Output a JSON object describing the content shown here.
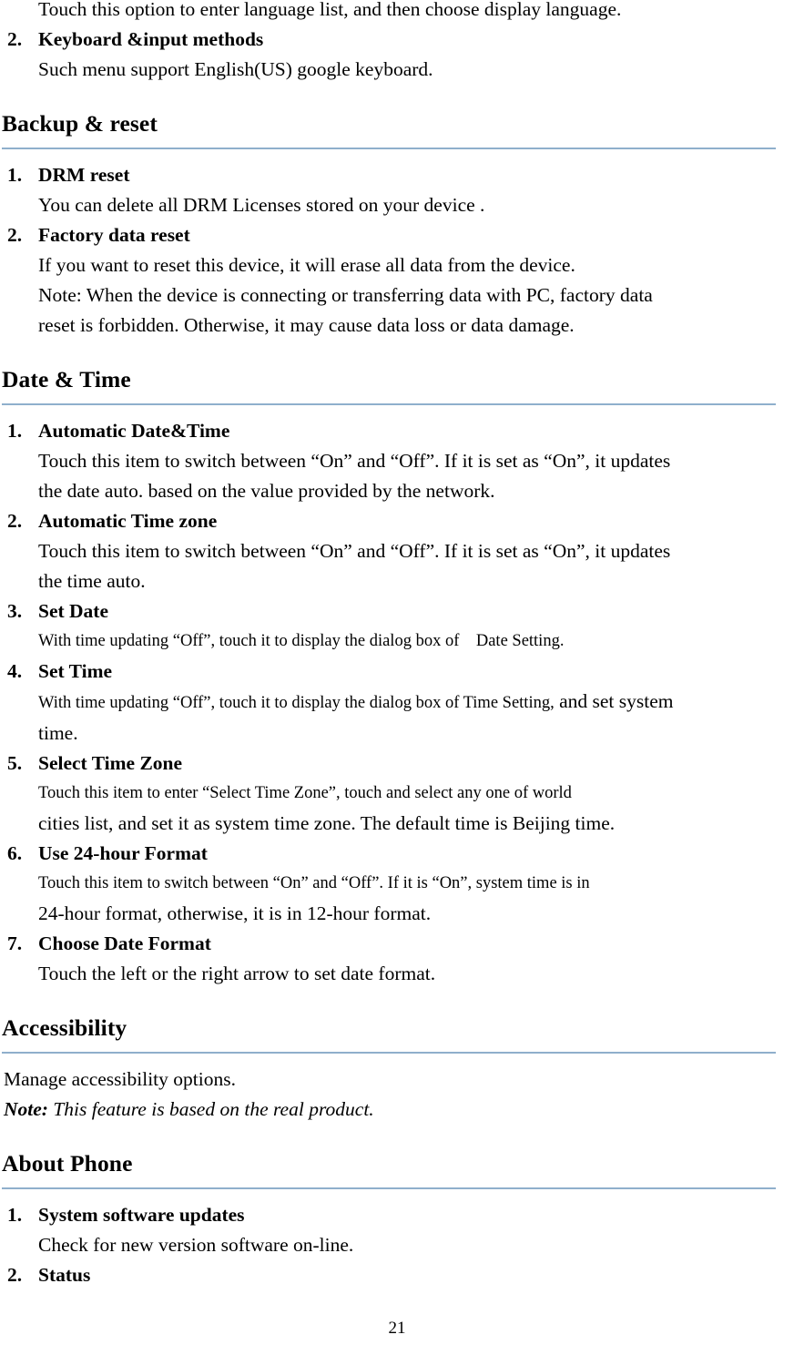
{
  "document": {
    "page_number": "21",
    "rule_color": "#8fafcc"
  },
  "top_fragment": {
    "continuation_line": "Touch this option to enter language list, and then choose display language.",
    "item": {
      "number": "2.",
      "title": "Keyboard &input methods",
      "body": "Such menu support English(US) google keyboard."
    }
  },
  "sections": [
    {
      "heading": "Backup & reset",
      "items": [
        {
          "number": "1.",
          "title": "DRM reset",
          "lines": [
            "You can delete all DRM Licenses stored on your device ."
          ]
        },
        {
          "number": "2.",
          "title": "Factory data reset",
          "lines": [
            "If you want to reset this device, it will erase all data from the device.",
            "Note: When the device is connecting or transferring data with PC, factory data",
            "reset is forbidden. Otherwise, it may cause data loss or data damage."
          ]
        }
      ]
    },
    {
      "heading": "Date & Time",
      "items": [
        {
          "number": "1.",
          "title": "Automatic Date&Time",
          "lines": [
            "Touch this item to switch between “On” and “Off”. If it is set as “On”, it updates",
            "the date auto. based on the value provided by the network."
          ]
        },
        {
          "number": "2.",
          "title": "Automatic Time zone",
          "lines": [
            "Touch this item to switch between “On” and “Off”. If it is set as “On”, it updates",
            "the time auto."
          ]
        },
        {
          "number": "3.",
          "title": "Set Date",
          "lines": [
            "With time updating “Off”, touch it to display the dialog box of    Date Setting."
          ]
        },
        {
          "number": "4.",
          "title": "Set Time",
          "line_small": "With time updating “Off”, touch it to display the dialog box of Time Setting,",
          "line_small_tail_big": " and set system",
          "line_after": "time."
        },
        {
          "number": "5.",
          "title": "Select Time Zone",
          "lines": [
            "Touch this item to enter “Select Time Zone”, touch and select any one of world",
            "cities list, and set it as system time zone. The default time is Beijing time."
          ]
        },
        {
          "number": "6.",
          "title": "Use 24-hour Format",
          "lines": [
            "Touch this item to switch between “On” and “Off”. If it is “On”, system time is in",
            "24-hour format, otherwise, it is in 12-hour format."
          ]
        },
        {
          "number": "7.",
          "title": "Choose Date Format",
          "lines": [
            "Touch the left or the right arrow to set date format."
          ]
        }
      ]
    },
    {
      "heading": "Accessibility",
      "plain_lines": [
        "Manage accessibility options."
      ],
      "note_label": "Note:",
      "note_text": " This feature is based on the real product."
    },
    {
      "heading": "About Phone",
      "items": [
        {
          "number": "1.",
          "title": "System software updates",
          "lines": [
            "Check for new version software on-line."
          ]
        },
        {
          "number": "2.",
          "title": "Status",
          "lines": []
        }
      ]
    }
  ]
}
